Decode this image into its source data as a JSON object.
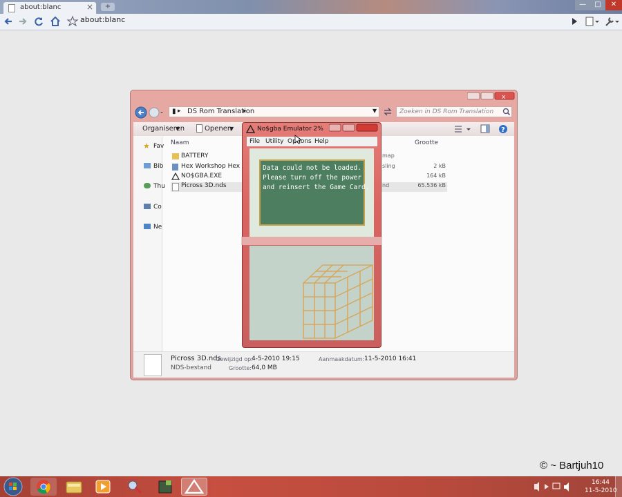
{
  "browser": {
    "tab_title": "about:blanc",
    "tab_close": "×",
    "new_tab": "+",
    "address": "about:blanc"
  },
  "explorer": {
    "breadcrumb": "DS Rom Translation",
    "search_placeholder": "Zoeken in DS Rom Translation",
    "cmd_organize": "Organiseren",
    "cmd_open": "Openen",
    "columns": {
      "name": "Naam",
      "size": "Grootte"
    },
    "files": [
      {
        "name": "BATTERY",
        "type": "map",
        "size": ""
      },
      {
        "name": "Hex Workshop Hex Edito",
        "type": "sling",
        "size": "2 kB"
      },
      {
        "name": "NO$GBA.EXE",
        "type": "",
        "size": "164 kB"
      },
      {
        "name": "Picross 3D.nds",
        "type": "nd",
        "size": "65.536 kB"
      }
    ],
    "nav": [
      "Fav",
      "Bib",
      "Thu",
      "Co",
      "Ne"
    ],
    "details": {
      "filename": "Picross 3D.nds",
      "filetype": "NDS-bestand",
      "modified_label": "Gewijzigd op:",
      "modified_value": "4-5-2010 19:15",
      "created_label": "Aanmaakdatum:",
      "created_value": "11-5-2010 16:41",
      "size_label": "Grootte:",
      "size_value": "64,0 MB"
    }
  },
  "nogba": {
    "title": "No$gba Emulator 2%",
    "menu": [
      "File",
      "Utility",
      "Options",
      "Help"
    ],
    "message": [
      "Data could not be loaded.",
      "Please turn off the power",
      "and reinsert the Game Card."
    ]
  },
  "watermark": "© ~ Bartjuh10",
  "clock": {
    "time": "16:44",
    "date": "11-5-2010"
  },
  "colors": {
    "taskbar": "#b84a3c",
    "explorer_frame": "#e0a4a0",
    "message_bg": "#4e7e60"
  }
}
